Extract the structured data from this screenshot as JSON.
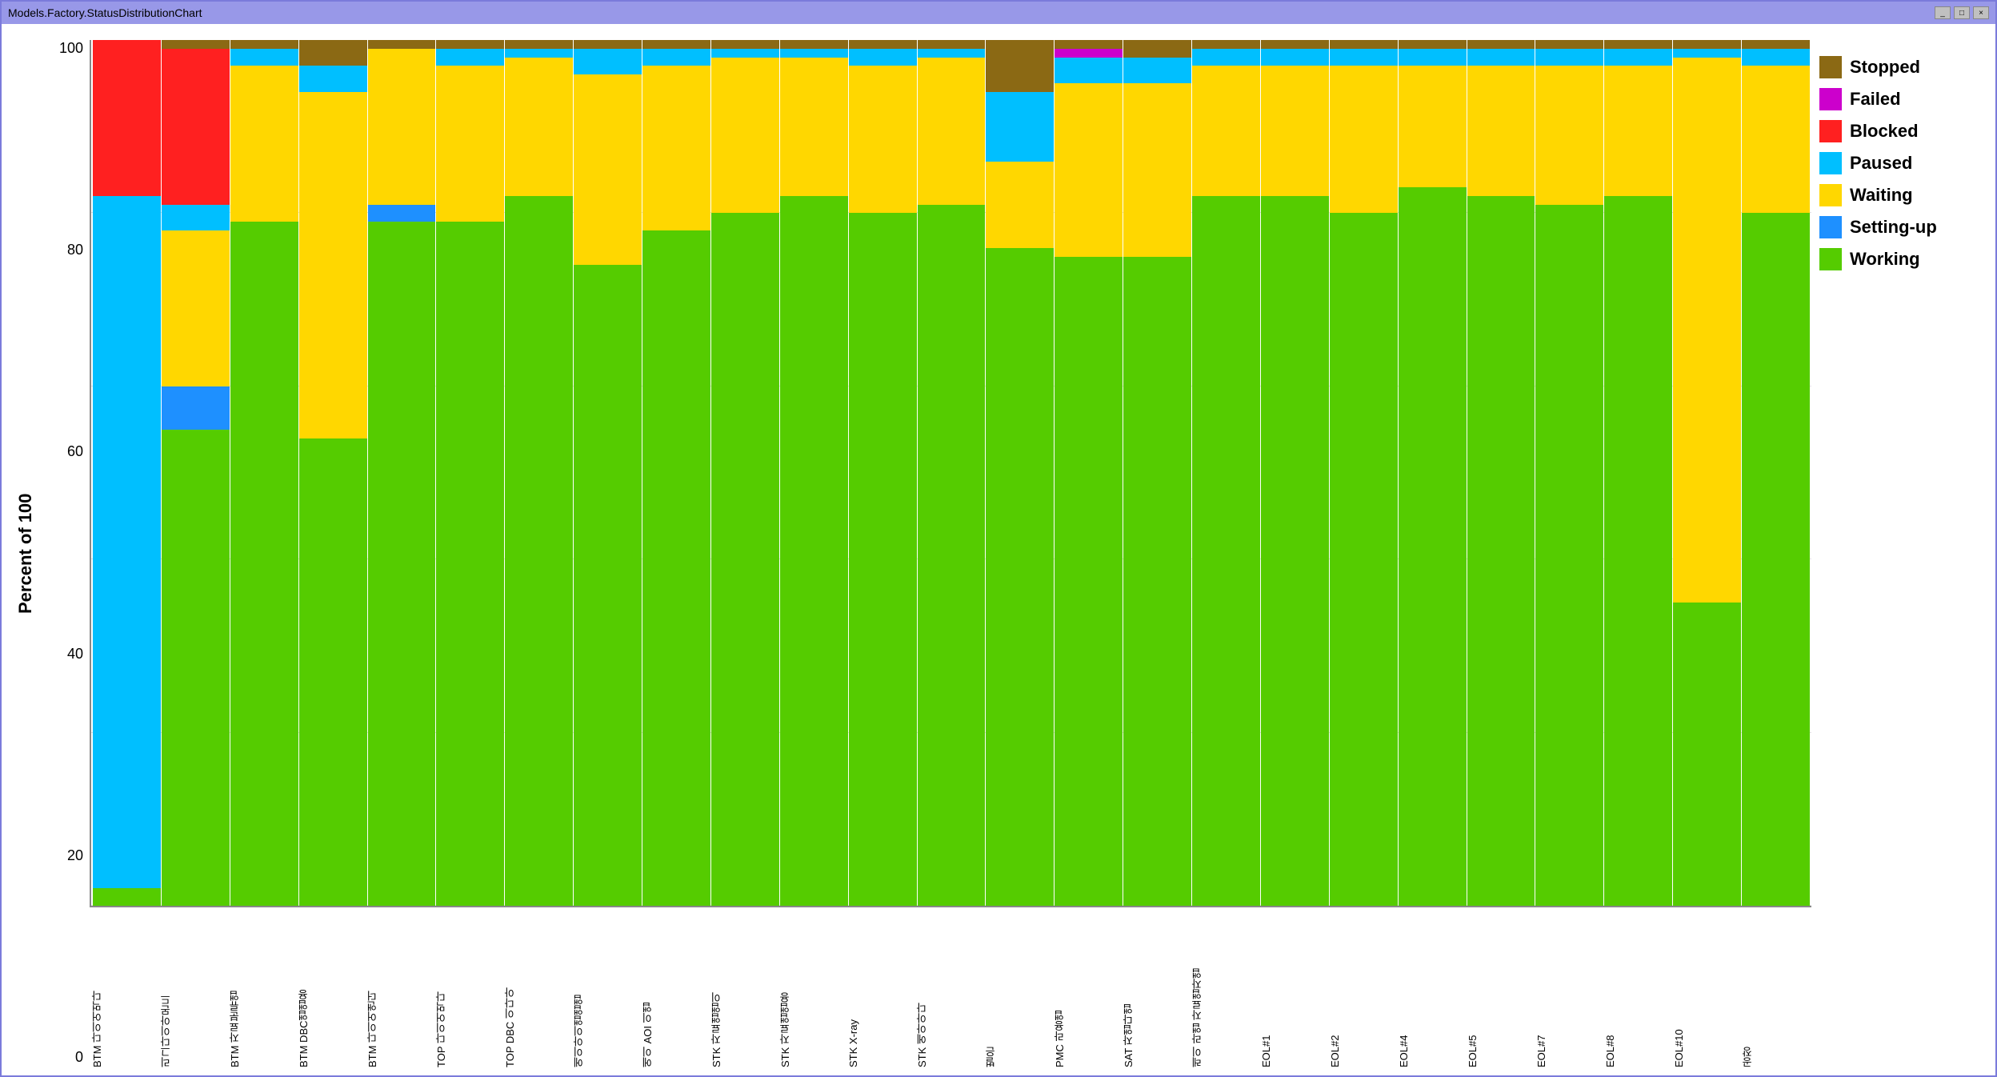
{
  "window": {
    "title": "Models.Factory.StatusDistributionChart",
    "buttons": [
      "_",
      "□",
      "×"
    ]
  },
  "yAxis": {
    "label": "Percent of 100",
    "ticks": [
      "100",
      "80",
      "60",
      "40",
      "20",
      "0"
    ]
  },
  "legend": {
    "items": [
      {
        "id": "stopped",
        "label": "Stopped",
        "color": "#8B6914"
      },
      {
        "id": "failed",
        "label": "Failed",
        "color": "#CC00CC"
      },
      {
        "id": "blocked",
        "label": "Blocked",
        "color": "#FF2020"
      },
      {
        "id": "paused",
        "label": "Paused",
        "color": "#00BFFF"
      },
      {
        "id": "waiting",
        "label": "Waiting",
        "color": "#FFD700"
      },
      {
        "id": "setting-up",
        "label": "Setting-up",
        "color": "#1E90FF"
      },
      {
        "id": "working",
        "label": "Working",
        "color": "#55CC00"
      }
    ]
  },
  "bars": [
    {
      "label": "BTM 다이어먹다",
      "working": 2,
      "settingUp": 0,
      "waiting": 0,
      "paused": 80,
      "blocked": 18,
      "failed": 0,
      "stopped": 0
    },
    {
      "label": "리그다이아몬드",
      "working": 55,
      "settingUp": 5,
      "waiting": 18,
      "paused": 3,
      "blocked": 18,
      "failed": 0,
      "stopped": 1
    },
    {
      "label": "BTM 자료분류앱",
      "working": 79,
      "settingUp": 0,
      "waiting": 18,
      "paused": 2,
      "blocked": 0,
      "failed": 0,
      "stopped": 1
    },
    {
      "label": "BTM DBC앱앱용",
      "working": 54,
      "settingUp": 0,
      "waiting": 40,
      "paused": 3,
      "blocked": 0,
      "failed": 0,
      "stopped": 3
    },
    {
      "label": "BTM 다이어앤더",
      "working": 79,
      "settingUp": 2,
      "waiting": 18,
      "paused": 0,
      "blocked": 0,
      "failed": 0,
      "stopped": 1
    },
    {
      "label": "TOP 다이어먹다",
      "working": 79,
      "settingUp": 0,
      "waiting": 18,
      "paused": 2,
      "blocked": 0,
      "failed": 0,
      "stopped": 1
    },
    {
      "label": "TOP DBC 이다아",
      "working": 82,
      "settingUp": 0,
      "waiting": 16,
      "paused": 1,
      "blocked": 0,
      "failed": 0,
      "stopped": 1
    },
    {
      "label": "에이아이앱앱앱",
      "working": 74,
      "settingUp": 0,
      "waiting": 22,
      "paused": 3,
      "blocked": 0,
      "failed": 0,
      "stopped": 1
    },
    {
      "label": "에이 AOI 이앱",
      "working": 78,
      "settingUp": 0,
      "waiting": 19,
      "paused": 2,
      "blocked": 0,
      "failed": 0,
      "stopped": 1
    },
    {
      "label": "STK 자료앱앱이",
      "working": 80,
      "settingUp": 0,
      "waiting": 18,
      "paused": 1,
      "blocked": 0,
      "failed": 0,
      "stopped": 1
    },
    {
      "label": "STK 자료앱앱용",
      "working": 82,
      "settingUp": 0,
      "waiting": 16,
      "paused": 1,
      "blocked": 0,
      "failed": 0,
      "stopped": 1
    },
    {
      "label": "STK X-ray",
      "working": 80,
      "settingUp": 0,
      "waiting": 17,
      "paused": 2,
      "blocked": 0,
      "failed": 0,
      "stopped": 1
    },
    {
      "label": "STK 에아아다",
      "working": 81,
      "settingUp": 0,
      "waiting": 17,
      "paused": 1,
      "blocked": 0,
      "failed": 0,
      "stopped": 1
    },
    {
      "label": "벌은",
      "working": 76,
      "settingUp": 0,
      "waiting": 10,
      "paused": 8,
      "blocked": 0,
      "failed": 0,
      "stopped": 6
    },
    {
      "label": "PMC 라용앱",
      "working": 75,
      "settingUp": 0,
      "waiting": 20,
      "paused": 3,
      "blocked": 0,
      "failed": 1,
      "stopped": 1
    },
    {
      "label": "SAT 자앱다앱",
      "working": 75,
      "settingUp": 0,
      "waiting": 20,
      "paused": 3,
      "blocked": 0,
      "failed": 0,
      "stopped": 2
    },
    {
      "label": "레이 라앱 자료앱자앱",
      "working": 82,
      "settingUp": 0,
      "waiting": 15,
      "paused": 2,
      "blocked": 0,
      "failed": 0,
      "stopped": 1
    },
    {
      "label": "EOL#1",
      "working": 82,
      "settingUp": 0,
      "waiting": 15,
      "paused": 2,
      "blocked": 0,
      "failed": 0,
      "stopped": 1
    },
    {
      "label": "EOL#2",
      "working": 80,
      "settingUp": 0,
      "waiting": 17,
      "paused": 2,
      "blocked": 0,
      "failed": 0,
      "stopped": 1
    },
    {
      "label": "EOL#4",
      "working": 83,
      "settingUp": 0,
      "waiting": 14,
      "paused": 2,
      "blocked": 0,
      "failed": 0,
      "stopped": 1
    },
    {
      "label": "EOL#5",
      "working": 82,
      "settingUp": 0,
      "waiting": 15,
      "paused": 2,
      "blocked": 0,
      "failed": 0,
      "stopped": 1
    },
    {
      "label": "EOL#7",
      "working": 81,
      "settingUp": 0,
      "waiting": 16,
      "paused": 2,
      "blocked": 0,
      "failed": 0,
      "stopped": 1
    },
    {
      "label": "EOL#8",
      "working": 82,
      "settingUp": 0,
      "waiting": 15,
      "paused": 2,
      "blocked": 0,
      "failed": 0,
      "stopped": 1
    },
    {
      "label": "EOL#10",
      "working": 35,
      "settingUp": 0,
      "waiting": 63,
      "paused": 1,
      "blocked": 0,
      "failed": 0,
      "stopped": 1
    },
    {
      "label": "공장",
      "working": 80,
      "settingUp": 0,
      "waiting": 17,
      "paused": 2,
      "blocked": 0,
      "failed": 0,
      "stopped": 1
    }
  ]
}
